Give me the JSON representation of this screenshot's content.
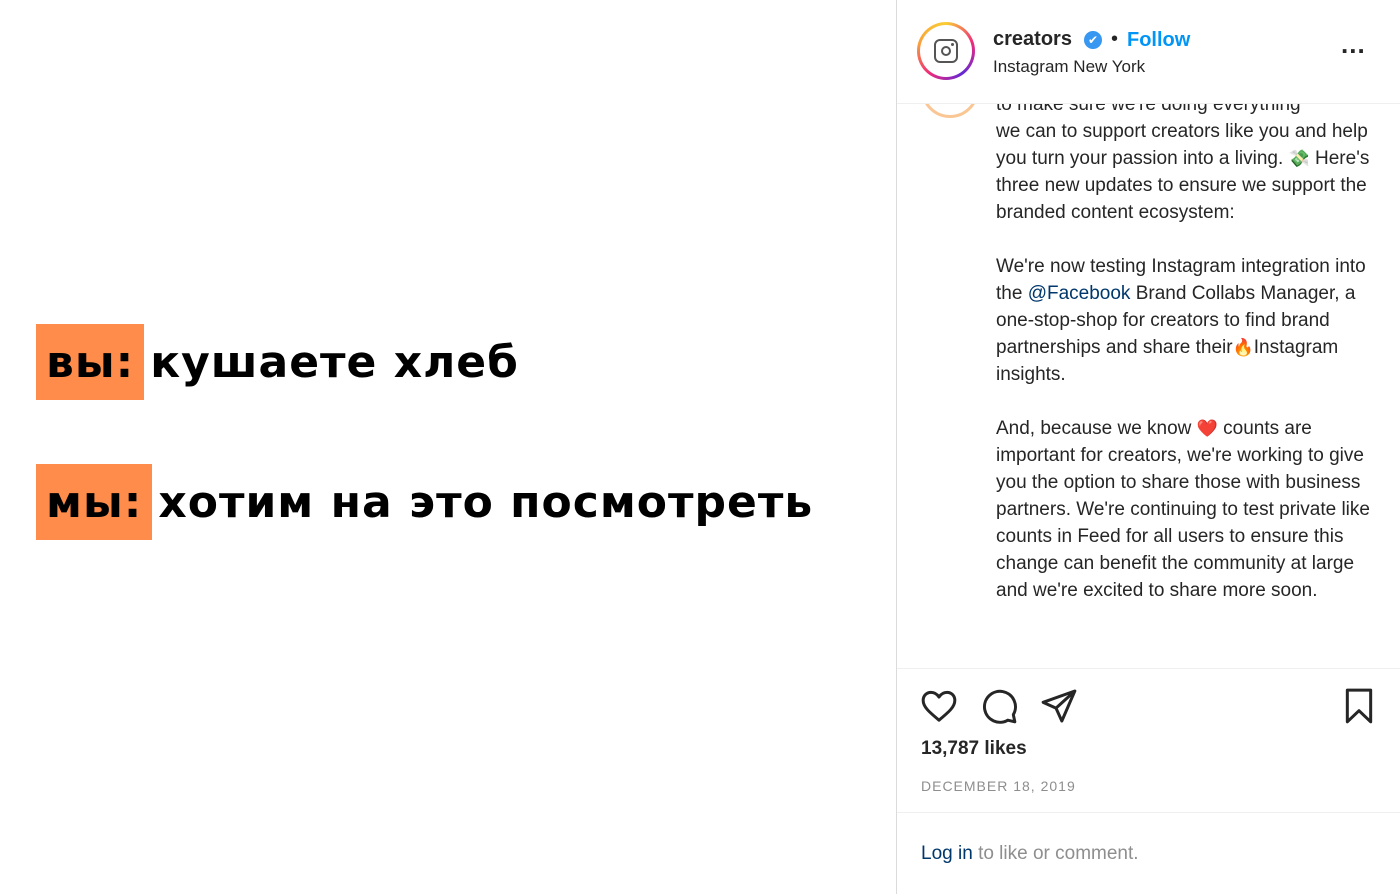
{
  "meme": {
    "line1": {
      "tag": "вы:",
      "text": "кушаете хлеб"
    },
    "line2": {
      "tag": "мы:",
      "text": "хотим на это посмотреть"
    },
    "accent_color": "#ff8c4a"
  },
  "post": {
    "header": {
      "username": "creators",
      "verified_icon": "✔",
      "separator": "•",
      "follow_label": "Follow",
      "location": "Instagram New York",
      "more_label": "..."
    },
    "caption": {
      "cut_line": "to make sure we're doing everything",
      "p1": "we can to support creators like you and help you turn your passion into a living.",
      "p1_emoji": "💸",
      "p1_rest": "Here's three new updates to ensure we support the branded content ecosystem:",
      "p2_before": "We're now testing Instagram integration into the",
      "p2_mention": "@Facebook",
      "p2_after": "Brand Collabs Manager, a one-stop-shop for creators to find brand partnerships and share their",
      "p2_emoji": "🔥",
      "p2_end": "Instagram insights.",
      "p3_before": "And, because we know",
      "p3_emoji": "❤️",
      "p3_after": "counts are important for creators, we're working to give you the option to share those with business partners. We're continuing to test private like counts in Feed for all users to ensure this change can benefit the community at large and we're excited to share more soon."
    },
    "likes": "13,787 likes",
    "date": "DECEMBER 18, 2019",
    "login": {
      "link": "Log in",
      "rest": "to like or comment."
    },
    "icons": [
      "heart-icon",
      "comment-icon",
      "share-icon",
      "bookmark-icon"
    ],
    "colors": {
      "link": "#0095f6",
      "mention": "#00376b",
      "muted": "#8e8e8e"
    }
  }
}
